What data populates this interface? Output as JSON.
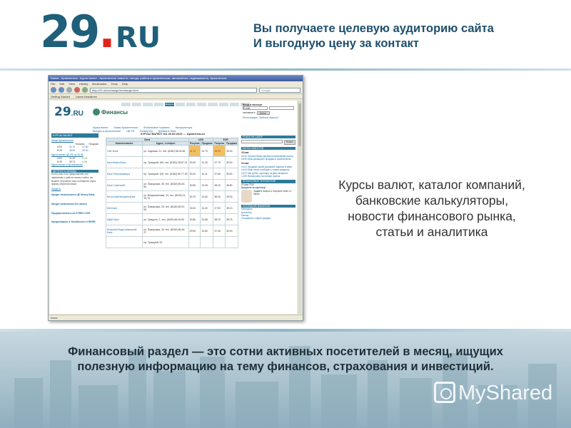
{
  "slide": {
    "logo": {
      "number": "29",
      "dot": ".",
      "ru": "RU"
    },
    "tagline": [
      "Вы получаете целевую аудиторию сайта",
      "И выгодную цену за контакт"
    ],
    "description": "Курсы валют, каталог компаний, банковские калькуляторы, новости финансового рынка, статьи и аналитика",
    "footer_text": "Финансовый раздел — это сотни активных посетителей в месяц, ищущих полезную информацию на тему финансов, страхования и инвестиций.",
    "brand": "MyShared"
  },
  "browser": {
    "title": "Банки - Архангельск - Курсы валют - Архангельск: новости, погода, работа в Архангельске, автомобили, недвижимость, Архангельск",
    "menu": [
      "File",
      "Edit",
      "View",
      "History",
      "Bookmarks",
      "Tools",
      "Help"
    ],
    "url": "http://29.ru/exchange/exchange.html",
    "search_placeholder": "Google",
    "bookmarks": [
      "Getting Started",
      "Latest Headlines"
    ],
    "status": "Done"
  },
  "site": {
    "logo_29": "29",
    "logo_ru": ".RU",
    "section_title": "Финансы",
    "tabs": [
      "",
      "",
      "",
      "",
      "финансы",
      "",
      "",
      "",
      "",
      "",
      "",
      ""
    ],
    "login": {
      "heading": "Вход в паспорт",
      "email": "E-mail",
      "password": "",
      "login_btn": "Войти",
      "remember": "запомнить",
      "register": "Регистрация",
      "forgot": "Забыли пароль?"
    },
    "subnav": [
      "Курсы валют",
      "Банки Архангельска",
      "Финансовые термины",
      "Калькуляторы"
    ],
    "subnav2": [
      "Вклады в Архангельске",
      "ЦБ РФ",
      "Конвертер",
      "Добавить банк"
    ],
    "rates_heading": "КУРСЫ ВАЛЮТ",
    "left": {
      "bank_link": "Банки Архангельска",
      "cols": [
        "Покупка",
        "Продажа"
      ],
      "rows": [
        [
          "USD",
          "31.70",
          "31.80"
        ],
        [
          "EUR",
          "38.90",
          "39.00"
        ]
      ],
      "cb_link": "Курсы валют ЦБ РФ на 26.05",
      "cb_rows": [
        [
          "USD",
          "31.45",
          "0.19"
        ],
        [
          "EUR",
          "38.73",
          "0.36"
        ]
      ],
      "more": "Курсы валют в Архангельске",
      "section": "ДЕПОЗИТЫ ВКЛАДЫ",
      "section_text": "Если у вас есть предложение или замечания о работе нашего сайта, вы можете отправить нам сообщение через форму обратной связи.",
      "section2": "Кредиты",
      "links": [
        "Кредит наличными в ЦЕ Money Bank",
        "Кредит наличными без залога",
        "Продажа валюты на FOREX.COM",
        "Кредитование в Челябинске от ВЕФБ"
      ]
    },
    "right": {
      "search_head": "ПОИСК НА САЙТЕ",
      "search_btn": "Искать",
      "news_head": "ЛЕНТА НОВОСТЕЙ",
      "news": [
        {
          "date": "25 мая",
          "items": [
            "09:30 Лучшие банки держатся банковский сектор",
            "18:45 Банк расширяет продажи в Архангельске"
          ]
        },
        {
          "date": "24 мая",
          "items": [
            "14:01 Продажи самой доходной подписи в мире",
            "14:00 Банк очень сообщает о новых кредитах",
            "13:47 Как рубль к доллару за день вырастет",
            "12:55 Финансовое состояние группы"
          ]
        }
      ],
      "tech_head": "ФИНАНСОВЫЕ ТЕХНОЛОГИИ",
      "tech_date": "20 мая 2010",
      "tech_title": "Кредитка за карточку!",
      "tech_text": "Задайте вопрос и получите ответ от банка",
      "vac_head": "ПОСЛЕДНИЕ ВАКАНСИИ",
      "vacancies": [
        "Менеджер",
        "Бухгалтер",
        "Кассир",
        "Специалист отдела продаж"
      ]
    },
    "table_title": "КУРСЫ ВАЛЮТ НА 26.05.2010 — Архангельск",
    "table_head": [
      "Наименование",
      "Адрес, телефон",
      "Покупка",
      "Продажа",
      "Покупка",
      "Продажа"
    ],
    "table_group": [
      "Банк",
      "",
      "USD",
      "",
      "EUR",
      ""
    ],
    "rows": [
      [
        "СКБ-Банк",
        "ул. Садовая, 21, тел. (8182) 65-40-65",
        "31.72",
        "31.79",
        "38.90",
        "39.00"
      ],
      [
        "БалтИнвестБанк",
        "пр. Троицкий, 160, тел. (8182) 28-67-31",
        "30.00",
        "31.25",
        "37.75",
        "39.00"
      ],
      [
        "Банк Петрокоммерц",
        "пр. Троицкий, 100, тел. (8182) 65-77-29",
        "30.20",
        "32.11",
        "37.65",
        "39.00"
      ],
      [
        "Банк Советский",
        "ул. Поморская, 45, тел. (8182) 65-63-94",
        "30.50",
        "31.05",
        "38.20",
        "38.80"
      ],
      [
        "ВосточныйЭкспрессБанк",
        "ул. Воскресенская, 14, тел. (8182) 21-19-76",
        "30.70",
        "31.60",
        "38.00",
        "39.00"
      ],
      [
        "МИ-Банк",
        "ул. Поморская, 28, тел. (8182) 65-92-08",
        "30.00",
        "31.20",
        "37.90",
        "39.10"
      ],
      [
        "МДМ Банк",
        "ул. Урицкого, 1, тел. (8182) 68-00-90",
        "30.80",
        "31.58",
        "38.23",
        "38.75"
      ],
      [
        "Морской Индустриальный Банк",
        "ул. Поморская, 34, тел. (8182) 65-46-27",
        "29.90",
        "31.50",
        "37.45",
        "39.00"
      ],
      [
        "",
        "пр. Троицкий, 94",
        "",
        "",
        "",
        ""
      ]
    ]
  }
}
